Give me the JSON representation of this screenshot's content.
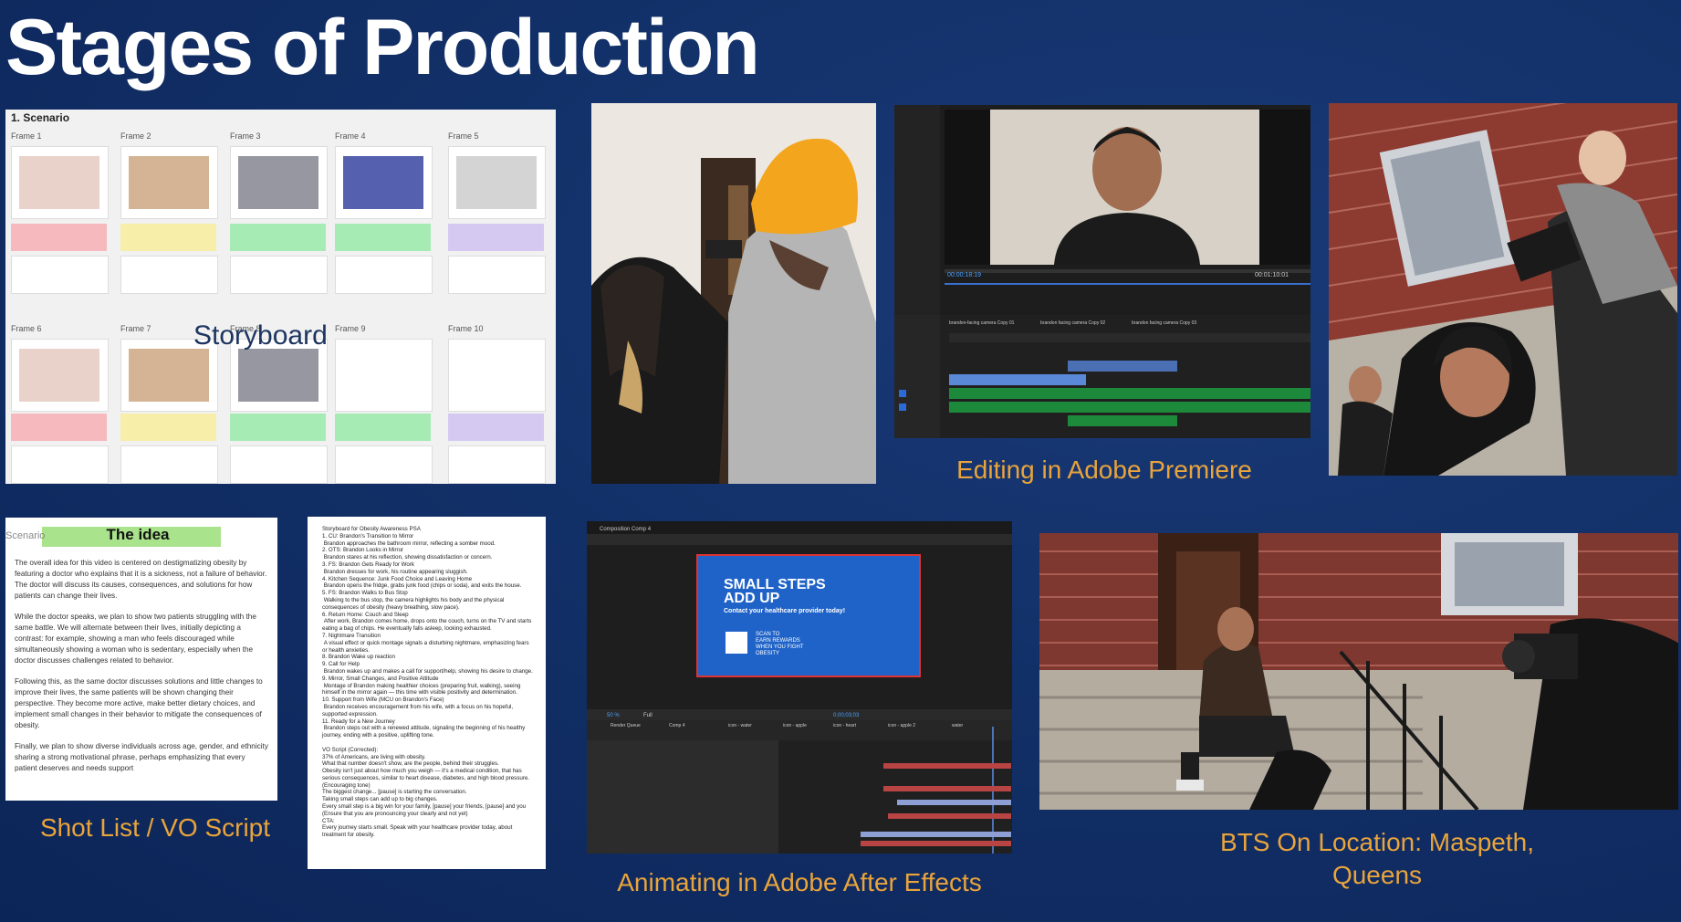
{
  "title": "Stages of Production",
  "storyboard": {
    "heading": "1. Scenario",
    "label": "Storyboard",
    "frames_row1": [
      "Frame 1",
      "Frame 2",
      "Frame 3",
      "Frame 4",
      "Frame 5"
    ],
    "frames_row2": [
      "Frame 6",
      "Frame 7",
      "Frame 8",
      "Frame 9",
      "Frame 10"
    ],
    "note_colors": [
      "#f6b9bd",
      "#f7eeaa",
      "#a7ebb4",
      "#a7ebb4",
      "#d5c9f2"
    ]
  },
  "idea": {
    "scenario": "Scenario",
    "title": "The idea",
    "p1": "The overall idea for this video is centered on destigmatizing obesity by featuring a doctor who explains that it is a sickness, not a failure of behavior. The doctor will discuss its causes, consequences, and solutions for how patients can change their lives.",
    "p2": "While the doctor speaks, we plan to show two patients struggling with the same battle. We will alternate between their lives, initially depicting a contrast: for example, showing a man who feels discouraged while simultaneously showing a woman who is sedentary, especially when the doctor discusses challenges related to behavior.",
    "p3": "Following this, as the same doctor discusses solutions and little changes to improve their lives, the same patients will be shown changing their perspective. They become more active, make better dietary choices, and implement small changes in their behavior to mitigate the consequences of obesity.",
    "p4": "Finally, we plan to show diverse individuals across age, gender, and ethnicity sharing a strong motivational phrase, perhaps emphasizing that every patient deserves and needs support"
  },
  "script": {
    "text": "Storyboard for Obesity Awareness PSA\n1. CU: Brandon's Transition to Mirror\n Brandon approaches the bathroom mirror, reflecting a somber mood.\n2. OTS: Brandon Looks in Mirror\n Brandon stares at his reflection, showing dissatisfaction or concern.\n3. FS: Brandon Gets Ready for Work\n Brandon dresses for work, his routine appearing sluggish.\n4. Kitchen Sequence: Junk Food Choice and Leaving Home\n Brandon opens the fridge, grabs junk food (chips or soda), and exits the house.\n5. FS: Brandon Walks to Bus Stop\n Walking to the bus stop, the camera highlights his body and the physical consequences of obesity (heavy breathing, slow pace).\n6. Return Home: Couch and Sleep\n After work, Brandon comes home, drops onto the couch, turns on the TV and starts eating a bag of chips. He eventually falls asleep, looking exhausted.\n7. Nightmare Transition\n A visual effect or quick montage signals a disturbing nightmare, emphasizing fears or health anxieties.\n8. Brandon Wake up reaction\n9. Call for Help\n Brandon wakes up and makes a call for support/help, showing his desire to change.\n9. Mirror, Small Changes, and Positive Attitude\n Montage of Brandon making healthier choices (preparing fruit, walking), seeing himself in the mirror again — this time with visible positivity and determination.\n10. Support from Wife (MCU on Brandon's Face)\n Brandon receives encouragement from his wife, with a focus on his hopeful, supported expression.\n11. Ready for a New Journey\n Brandon steps out with a renewed attitude, signaling the beginning of his healthy journey, ending with a positive, uplifting tone.\n\nVO Script (Corrected):\n37% of Americans, are living with obesity.\nWhat that number doesn't show, are the people, behind their struggles.\nObesity isn't just about how much you weigh — it's a medical condition, that has serious consequences, similar to heart disease, diabetes, and high blood pressure.\n(Encouraging tone)\nThe biggest change... [pause] is starting the conversation.\nTaking small steps can add up to big changes.\nEvery small step is a big win for your family, [pause] your friends, [pause] and you\n(Ensure that you are pronouncing your clearly and not yet)\nCTA:\nEvery journey starts small. Speak with your healthcare provider today, about treatment for obesity."
  },
  "premiere": {
    "timecode_left": "00:00:18:19",
    "timecode_right": "00:01:10:01",
    "track_labels": [
      "brandon-facing camera Copy 01",
      "brandon facing camera Copy 02",
      "brandon facing camera Copy 03"
    ]
  },
  "after_effects": {
    "panel": "Composition Comp 4",
    "big_text": "SMALL STEPS\nADD UP",
    "sub_text": "Contact your healthcare provider today!",
    "scan_text": "SCAN TO\nEARN REWARDS\nWHEN YOU FIGHT\nOBESITY",
    "zoom": "50 %",
    "quality": "Full",
    "timecode": "0;00;03;03",
    "tabs": [
      "Render Queue",
      "Comp 4",
      "icon - water",
      "icon - apple",
      "icon - heart",
      "icon - apple 2",
      "water"
    ]
  },
  "captions": {
    "premiere": "Editing in Adobe Premiere",
    "shot_list": "Shot List / VO Script",
    "after_effects": "Animating in Adobe After Effects",
    "bts": "BTS On Location: Maspeth,\nQueens"
  }
}
